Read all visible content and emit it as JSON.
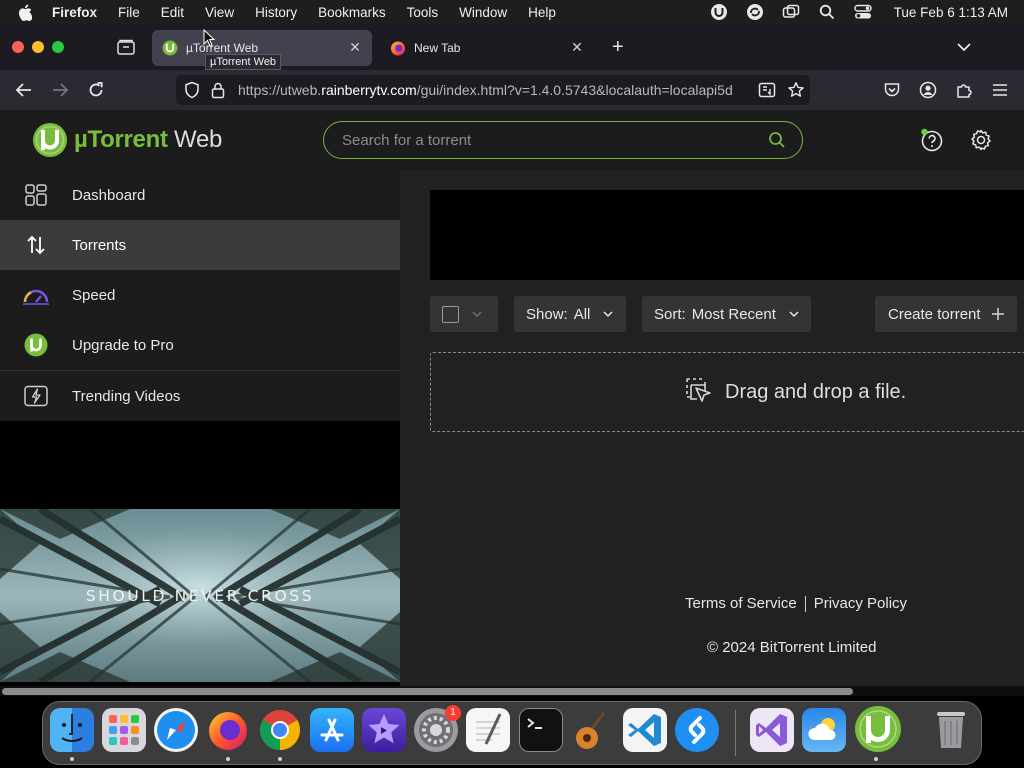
{
  "menubar": {
    "app_name": "Firefox",
    "items": [
      "File",
      "Edit",
      "View",
      "History",
      "Bookmarks",
      "Tools",
      "Window",
      "Help"
    ],
    "clock": "Tue Feb 6  1:13 AM"
  },
  "browser": {
    "tabs": [
      {
        "title": "µTorrent Web",
        "active": true
      },
      {
        "title": "New Tab",
        "active": false
      }
    ],
    "tooltip": "µTorrent Web",
    "url_prefix": "https://utweb.",
    "url_domain": "rainberrytv.com",
    "url_path": "/gui/index.html?v=1.4.0.5743&localauth=localapi5d"
  },
  "app": {
    "brand_u": "µTorrent",
    "brand_w": " Web",
    "search_placeholder": "Search for a torrent",
    "accent": "#78bd3b",
    "sidebar": [
      {
        "label": "Dashboard",
        "icon": "dashboard-grid-icon",
        "selected": false
      },
      {
        "label": "Torrents",
        "icon": "up-down-arrows-icon",
        "selected": true
      },
      {
        "label": "Speed",
        "icon": "speedometer-icon",
        "selected": false
      },
      {
        "label": "Upgrade to Pro",
        "icon": "utorrent-logo-icon",
        "selected": false
      },
      {
        "label": "Trending Videos",
        "icon": "video-lightning-icon",
        "selected": false
      }
    ],
    "video_caption": "SHOULD NEVER CROSS",
    "toolbar": {
      "show_label": "Show:",
      "show_value": "All",
      "sort_label": "Sort:",
      "sort_value": "Most Recent",
      "create_label": "Create torrent"
    },
    "dropzone_text": "Drag and drop a file.",
    "footer": {
      "terms": "Terms of Service",
      "privacy": "Privacy Policy",
      "copyright": "© 2024 BitTorrent Limited"
    }
  },
  "dock": {
    "apps": [
      "Finder",
      "Launchpad",
      "Safari",
      "Firefox",
      "Chrome",
      "App Store",
      "iMovie",
      "System Settings",
      "TextEdit",
      "Terminal",
      "GarageBand",
      "Visual Studio Code",
      "Shazam",
      "Visual Studio",
      "Weather",
      "µTorrent Web",
      "Trash"
    ],
    "settings_badge": "1"
  }
}
